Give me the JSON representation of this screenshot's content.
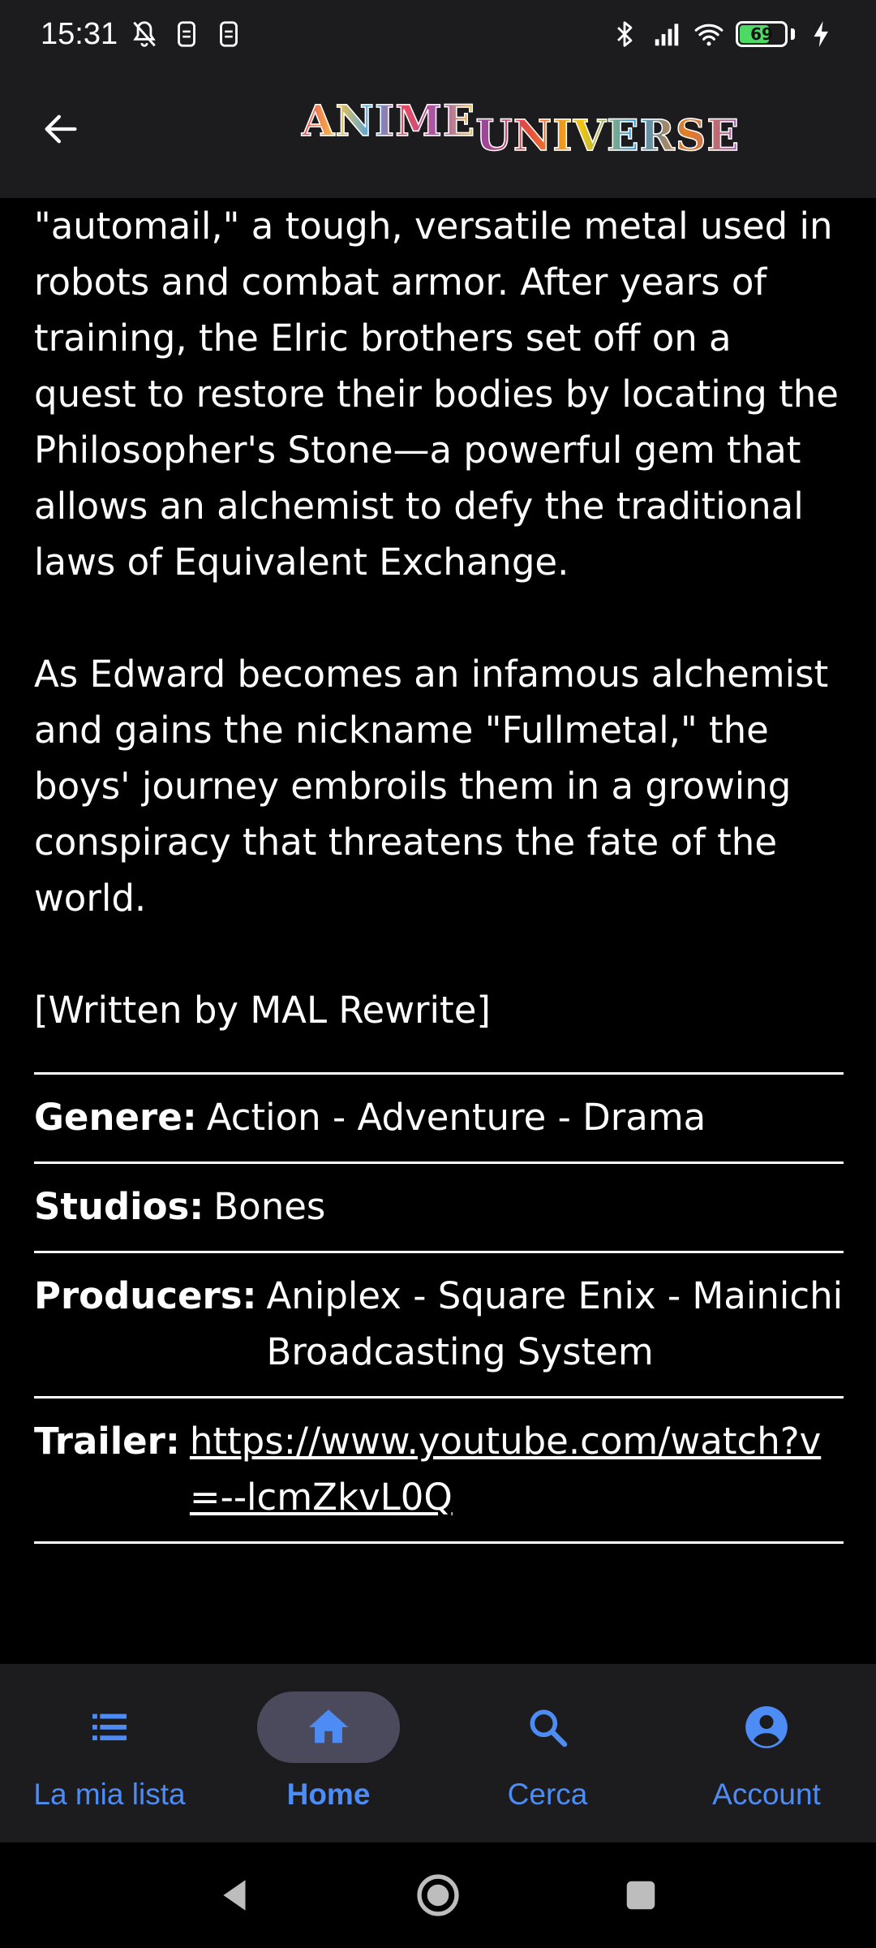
{
  "status_bar": {
    "time": "15:31",
    "battery_percent": 69,
    "battery_label": "69",
    "icons": [
      "bell-off-icon",
      "sim-icon",
      "sim-icon",
      "bluetooth-icon",
      "signal-icon",
      "wifi-icon",
      "battery-icon",
      "charging-icon"
    ]
  },
  "app_bar": {
    "logo_part1": "ANIME",
    "logo_part2": "UNIVERSE",
    "back_icon": "arrow-left-icon"
  },
  "synopsis": {
    "paragraph1": "\"automail,\" a tough, versatile metal used in robots and combat armor. After years of training, the Elric brothers set off on a quest to restore their bodies by locating the Philosopher's Stone—a powerful gem that allows an alchemist to defy the traditional laws of Equivalent Exchange.",
    "paragraph2": "As Edward becomes an infamous alchemist and gains the nickname \"Fullmetal,\" the boys' journey embroils them in a growing conspiracy that threatens the fate of the world.",
    "credit": "[Written by MAL Rewrite]"
  },
  "details": {
    "genre_label": "Genere:",
    "genre_value": "Action - Adventure - Drama",
    "studios_label": "Studios:",
    "studios_value": "Bones",
    "producers_label": "Producers:",
    "producers_value": "Aniplex - Square Enix - Mainichi Broadcasting System",
    "trailer_label": "Trailer:",
    "trailer_url": "https://www.youtube.com/watch?v=--lcmZkvL0Q"
  },
  "bottom_nav": {
    "items": [
      {
        "label": "La mia lista",
        "icon": "list-icon",
        "active": false
      },
      {
        "label": "Home",
        "icon": "home-icon",
        "active": true
      },
      {
        "label": "Cerca",
        "icon": "search-icon",
        "active": false
      },
      {
        "label": "Account",
        "icon": "account-circle-icon",
        "active": false
      }
    ],
    "accent_color": "#4d8cf5",
    "active_pill_color": "#4a4a5c"
  },
  "colors": {
    "background": "#000000",
    "bar_background": "#1c1c1e",
    "text": "#ffffff",
    "battery_fill": "#4cd964"
  }
}
